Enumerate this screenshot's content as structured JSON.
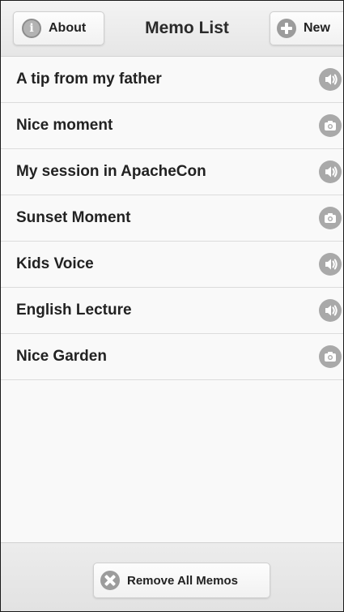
{
  "header": {
    "title": "Memo List",
    "about_label": "About",
    "about_icon": "info-icon",
    "new_label": "New",
    "new_icon": "plus-icon"
  },
  "memos": [
    {
      "label": "A tip from my father",
      "type": "audio",
      "icon": "audio-icon"
    },
    {
      "label": "Nice moment",
      "type": "photo",
      "icon": "camera-icon"
    },
    {
      "label": "My session in ApacheCon",
      "type": "audio",
      "icon": "audio-icon"
    },
    {
      "label": "Sunset Moment",
      "type": "photo",
      "icon": "camera-icon"
    },
    {
      "label": "Kids Voice",
      "type": "audio",
      "icon": "audio-icon"
    },
    {
      "label": "English Lecture",
      "type": "audio",
      "icon": "audio-icon"
    },
    {
      "label": "Nice Garden",
      "type": "photo",
      "icon": "camera-icon"
    }
  ],
  "footer": {
    "remove_all_label": "Remove All Memos",
    "remove_icon": "delete-icon"
  },
  "colors": {
    "header_bg": "#e9e9e9",
    "list_bg": "#f9f9f9",
    "icon_gray": "#a9a9a9",
    "text": "#222222"
  }
}
